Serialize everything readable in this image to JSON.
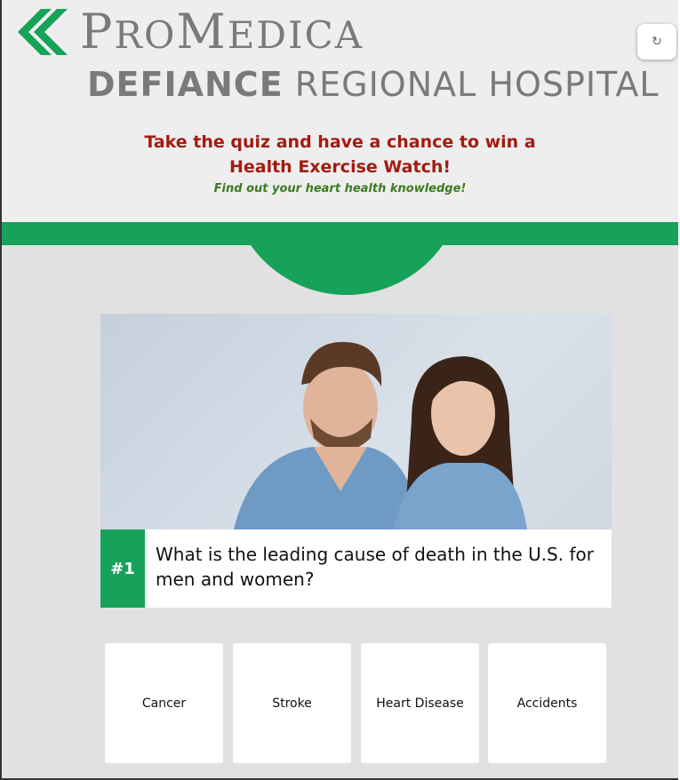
{
  "header": {
    "logo_icon": "promedica-chevron-logo",
    "brand_name_initial": "P",
    "brand_name_rest": "RO",
    "brand_name_initial2": "M",
    "brand_name_rest2": "EDICA",
    "hospital_bold": "DEFIANCE",
    "hospital_regular": " REGIONAL HOSPITAL",
    "refresh_icon": "refresh-icon"
  },
  "promo": {
    "line1": "Take the quiz and have a chance to win a",
    "line2": "Health Exercise Watch!",
    "subline": "Find out your heart health knowledge!"
  },
  "question": {
    "number": "#1",
    "text": "What is the leading cause of death in the U.S. for men and women?"
  },
  "answers": [
    {
      "label": "Cancer"
    },
    {
      "label": "Stroke"
    },
    {
      "label": "Heart Disease"
    },
    {
      "label": "Accidents"
    }
  ],
  "colors": {
    "brand_green": "#17a25a",
    "promo_red": "#a31b12",
    "promo_green": "#3d7a22",
    "logo_gray": "#7a7a7a"
  }
}
